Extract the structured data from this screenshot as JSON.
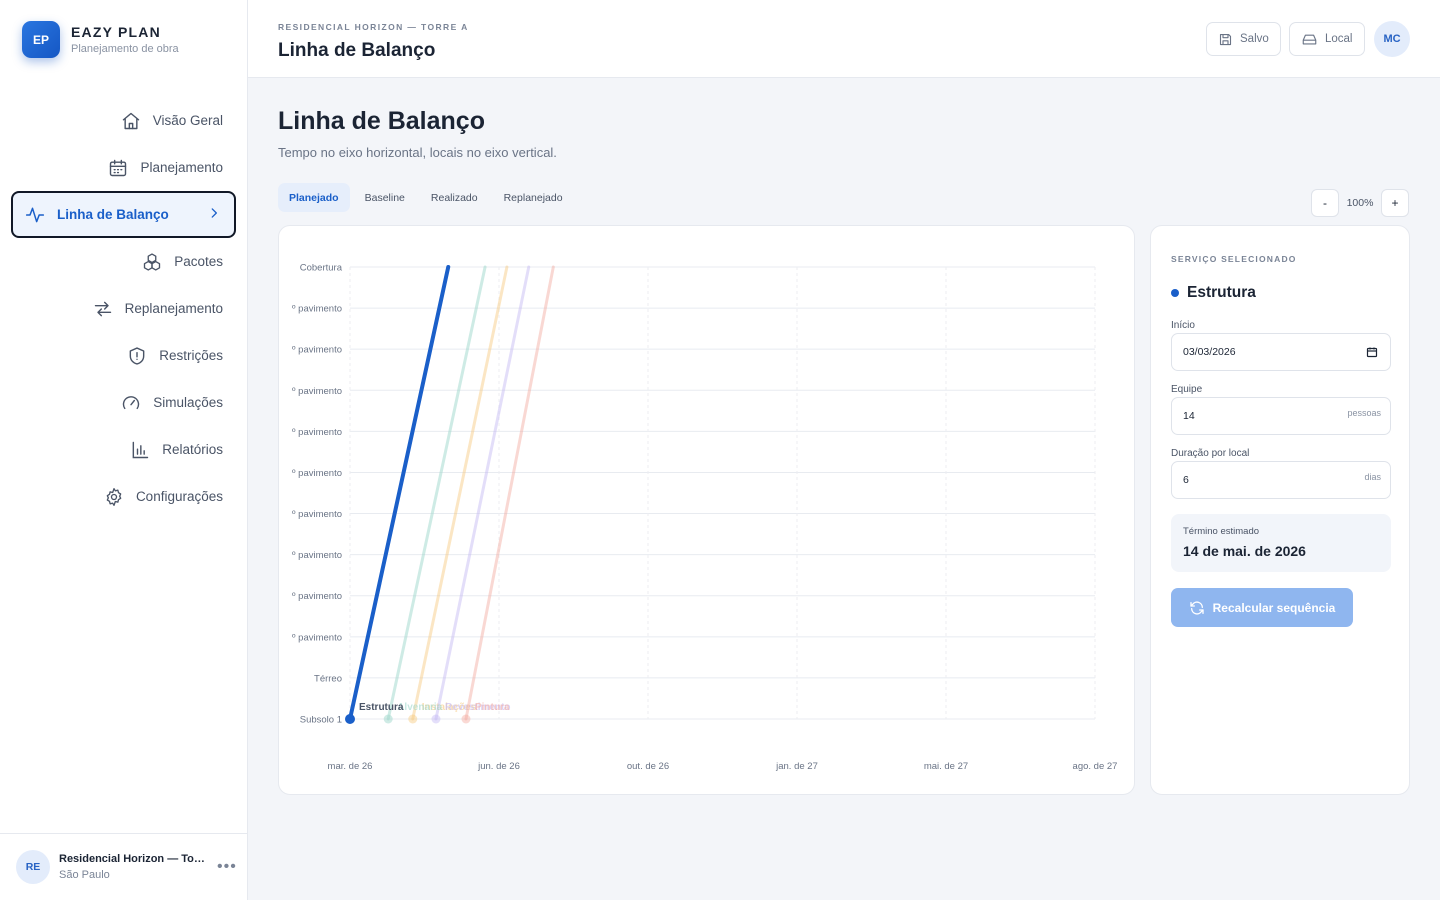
{
  "brand": {
    "logo": "EP",
    "name": "EAZY PLAN",
    "subtitle": "Planejamento de obra"
  },
  "nav": {
    "items": [
      {
        "label": "Visão Geral",
        "icon": "home-icon"
      },
      {
        "label": "Planejamento",
        "icon": "calendar-icon"
      },
      {
        "label": "Linha de Balanço",
        "icon": "activity-icon",
        "active": true
      },
      {
        "label": "Pacotes",
        "icon": "packages-icon"
      },
      {
        "label": "Replanejamento",
        "icon": "arrows-icon"
      },
      {
        "label": "Restrições",
        "icon": "shield-alert-icon"
      },
      {
        "label": "Simulações",
        "icon": "gauge-icon"
      },
      {
        "label": "Relatórios",
        "icon": "bar-chart-icon"
      },
      {
        "label": "Configurações",
        "icon": "gear-icon"
      }
    ]
  },
  "project": {
    "initials": "RE",
    "name": "Residencial Horizon — Torre A",
    "location": "São Paulo"
  },
  "header": {
    "breadcrumb": "RESIDENCIAL HORIZON — TORRE A",
    "title": "Linha de Balanço",
    "save_label": "Salvo",
    "local_label": "Local",
    "user_initials": "MC"
  },
  "page": {
    "title": "Linha de Balanço",
    "subtitle": "Tempo no eixo horizontal, locais no eixo vertical."
  },
  "tabs": [
    "Planejado",
    "Baseline",
    "Realizado",
    "Replanejado"
  ],
  "zoom": {
    "minus": "-",
    "value": "100%",
    "plus": "+"
  },
  "panel": {
    "section_title": "SERVIÇO SELECIONADO",
    "service_name": "Estrutura",
    "start_label": "Início",
    "start_value": "03/03/2026",
    "team_label": "Equipe",
    "team_value": "14",
    "team_unit": "pessoas",
    "duration_label": "Duração por local",
    "duration_value": "6",
    "duration_unit": "dias",
    "end_label": "Término estimado",
    "end_value": "14 de mai. de 2026",
    "recalc_label": "Recalcular sequência"
  },
  "chart_data": {
    "type": "line",
    "y_categories": [
      "Subsolo 1",
      "Térreo",
      "º pavimento",
      "º pavimento",
      "º pavimento",
      "º pavimento",
      "º pavimento",
      "º pavimento",
      "º pavimento",
      "º pavimento",
      "º pavimento",
      "Cobertura"
    ],
    "x_ticks": [
      "mar. de 26",
      "jun. de 26",
      "out. de 26",
      "jan. de 27",
      "mai. de 27",
      "ago. de 27"
    ],
    "xlim": [
      "2026-03-03",
      "2027-08-31"
    ],
    "grid": true,
    "series": [
      {
        "name": "Estrutura",
        "color": "#1a5fc9",
        "opacity": 1.0,
        "start": "2026-03-03",
        "end": "2026-05-14"
      },
      {
        "name": "Alvenaria",
        "color": "#9fd8cc",
        "opacity": 0.5,
        "start": "2026-03-31",
        "end": "2026-06-10"
      },
      {
        "name": "Instalações",
        "color": "#f7c97e",
        "opacity": 0.45,
        "start": "2026-04-18",
        "end": "2026-06-26"
      },
      {
        "name": "Revestimento",
        "color": "#c3b7f3",
        "opacity": 0.45,
        "start": "2026-05-05",
        "end": "2026-07-12"
      },
      {
        "name": "Pintura",
        "color": "#f3aaa0",
        "opacity": 0.45,
        "start": "2026-05-27",
        "end": "2026-07-30"
      }
    ]
  }
}
